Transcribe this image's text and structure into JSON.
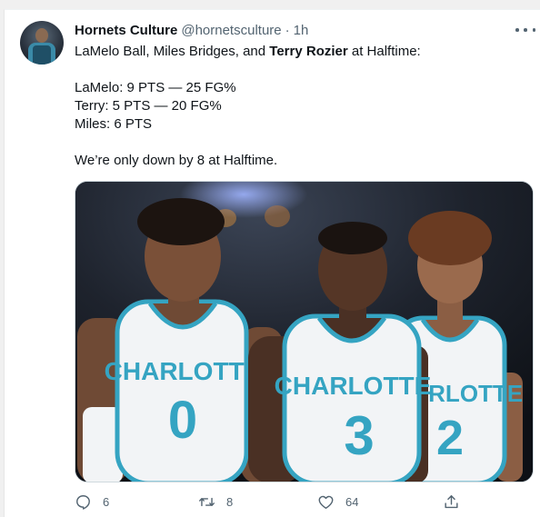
{
  "tweet": {
    "author_name": "Hornets Culture",
    "author_handle": "@hornetsculture",
    "separator": "·",
    "time": "1h",
    "line1_prefix": "LaMelo Ball, Miles Bridges, and ",
    "line1_bold": "Terry Rozier",
    "line1_suffix": " at Halftime:",
    "stat_lines": [
      "LaMelo: 9 PTS — 25 FG%",
      "Terry: 5 PTS — 20 FG%",
      "Miles: 6 PTS"
    ],
    "closing_line": "We’re only down by 8 at Halftime.",
    "media": {
      "jersey_text": "CHARLOTTE",
      "numbers": [
        "0",
        "3",
        "2"
      ],
      "jersey_color": "#f2f4f6",
      "trim_color": "#35a4c2"
    }
  },
  "actions": {
    "reply_count": "6",
    "retweet_count": "8",
    "like_count": "64",
    "icons": [
      "reply-icon",
      "retweet-icon",
      "like-icon",
      "share-icon"
    ]
  }
}
